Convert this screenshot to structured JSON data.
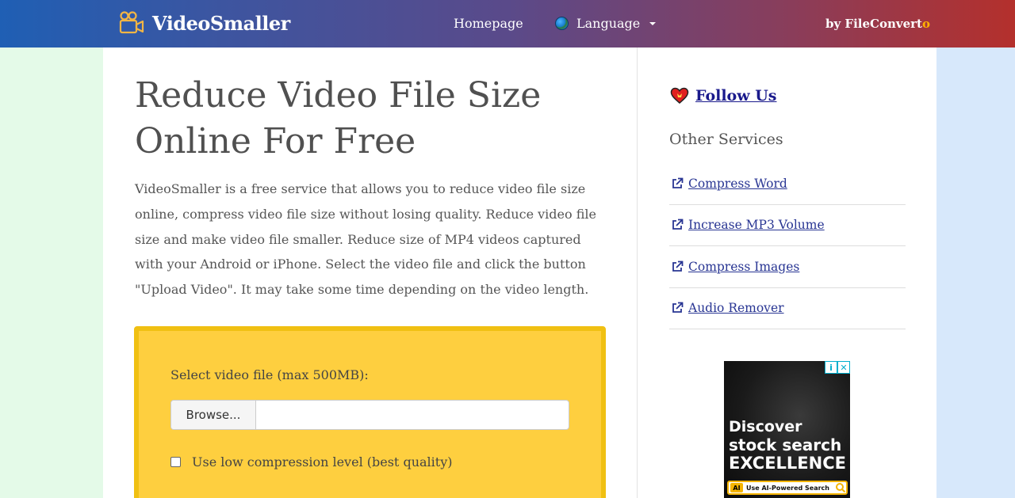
{
  "header": {
    "logo_text": "VideoSmaller",
    "nav_home": "Homepage",
    "nav_language": "Language",
    "by_prefix": "by FileConvert",
    "by_suffix": "o"
  },
  "main": {
    "title_line1": "Reduce Video File Size",
    "title_line2": "Online For Free",
    "description": "VideoSmaller is a free service that allows you to reduce video file size online, compress video file size without losing quality. Reduce video file size and make video file smaller. Reduce size of MP4 videos captured with your Android or iPhone. Select the video file and click the button \"Upload Video\". It may take some time depending on the video length.",
    "upload": {
      "select_label": "Select video file (max 500MB):",
      "browse_label": "Browse...",
      "file_value": "",
      "checkbox_label": "Use low compression level (best quality)",
      "checkbox_checked": false
    }
  },
  "sidebar": {
    "follow_label": "Follow Us",
    "other_title": "Other Services",
    "services": [
      {
        "label": " Compress Word"
      },
      {
        "label": " Increase MP3 Volume"
      },
      {
        "label": " Compress Images"
      },
      {
        "label": " Audio Remover"
      }
    ]
  },
  "ad": {
    "line1": "Discover",
    "line2": "stock search",
    "line3": "EXCELLENCE",
    "ai_badge": "AI",
    "search_text": "Use AI-Powered Search",
    "info_glyph": "i",
    "close_glyph": "✕"
  },
  "colors": {
    "accent_yellow": "#fecf3f",
    "box_border": "#f0c012",
    "link": "#283593",
    "left_bg": "#e4fae8",
    "right_bg": "#d7e8fb"
  },
  "icons": [
    "camera-icon",
    "globe-icon",
    "heart-icon",
    "external-link-icon",
    "search-icon"
  ]
}
